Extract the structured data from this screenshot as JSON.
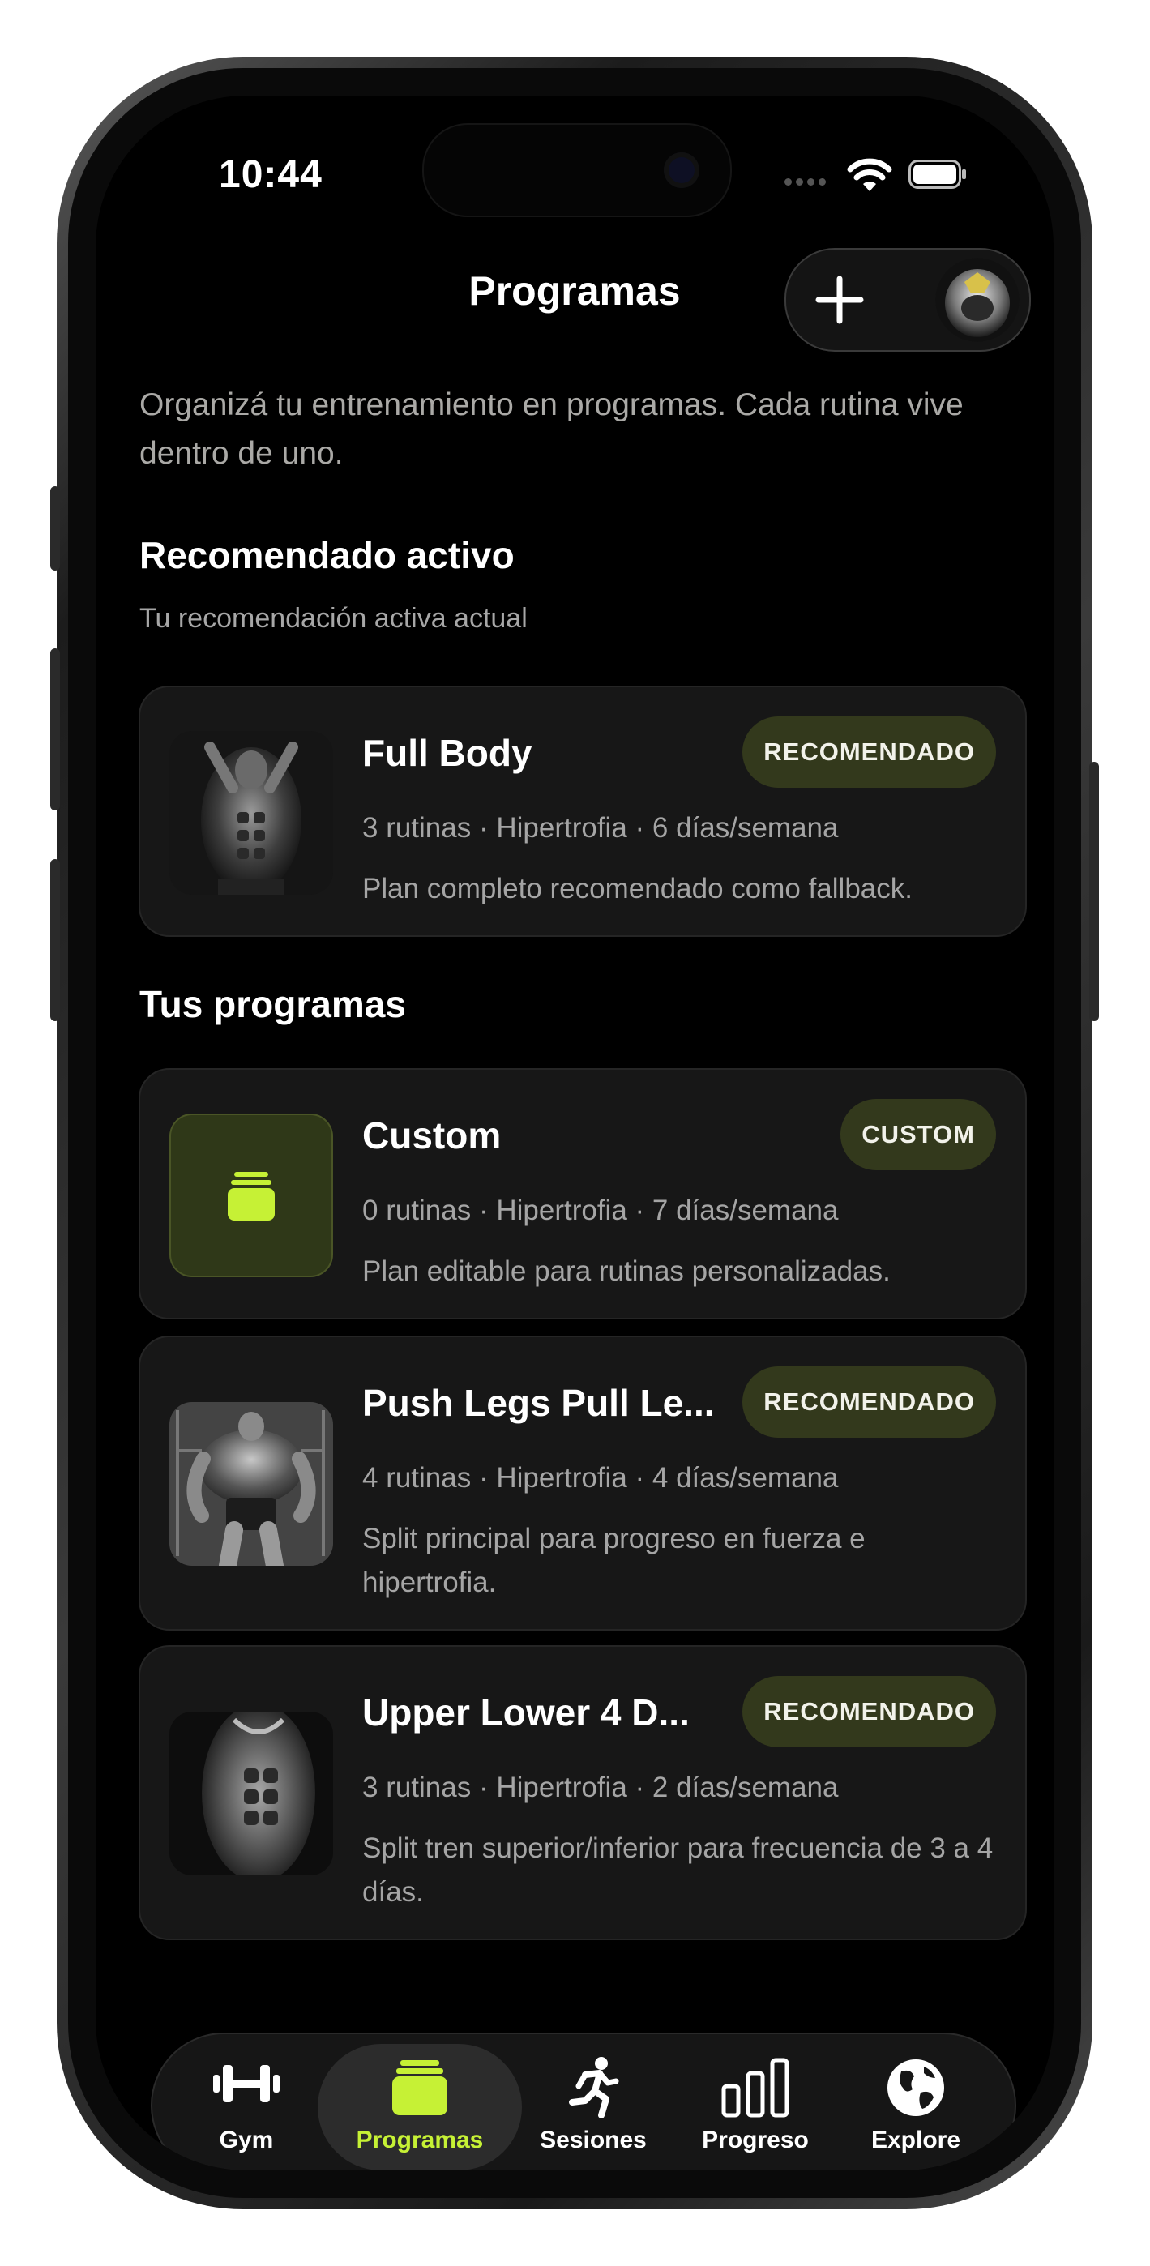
{
  "status_bar": {
    "time": "10:44"
  },
  "header": {
    "title": "Programas",
    "add_icon": "plus-icon",
    "avatar_icon": "profile-avatar"
  },
  "intro": "Organizá tu entrenamiento en programas. Cada rutina vive dentro de uno.",
  "recommended_section": {
    "title": "Recomendado activo",
    "subtitle": "Tu recomendación activa actual",
    "program": {
      "name": "Full Body",
      "badge": "RECOMENDADO",
      "meta": "3 rutinas · Hipertrofia · 6 días/semana",
      "description": "Plan completo recomendado como fallback."
    }
  },
  "my_programs": {
    "title": "Tus programas",
    "items": [
      {
        "name": "Custom",
        "badge": "CUSTOM",
        "meta": "0 rutinas · Hipertrofia · 7 días/semana",
        "description": "Plan editable para rutinas personalizadas."
      },
      {
        "name": "Push Legs Pull Le...",
        "badge": "RECOMENDADO",
        "meta": "4 rutinas · Hipertrofia · 4 días/semana",
        "description": "Split principal para progreso en fuerza e hipertrofia."
      },
      {
        "name": "Upper Lower 4 D...",
        "badge": "RECOMENDADO",
        "meta": "3 rutinas · Hipertrofia · 2 días/semana",
        "description": "Split tren superior/inferior para frecuencia de 3 a 4 días."
      }
    ]
  },
  "tab_bar": {
    "active": "Programas",
    "tabs": [
      {
        "label": "Gym",
        "icon": "dumbbell-icon"
      },
      {
        "label": "Programas",
        "icon": "programs-stack-icon"
      },
      {
        "label": "Sesiones",
        "icon": "running-icon"
      },
      {
        "label": "Progreso",
        "icon": "bar-chart-icon"
      },
      {
        "label": "Explore",
        "icon": "globe-icon"
      }
    ]
  },
  "colors": {
    "accent": "#c6f135",
    "badge_bg": "#33391c",
    "card_bg": "#171717",
    "screen_bg": "#000000"
  }
}
